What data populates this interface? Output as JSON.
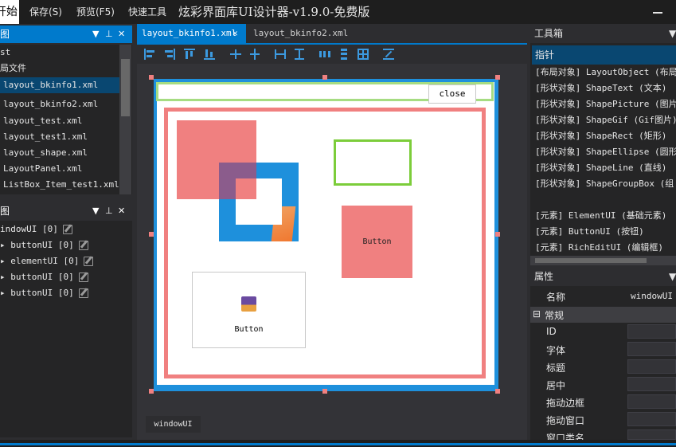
{
  "menubar": {
    "start_label": "开始",
    "save_label": "保存(S)",
    "preview_label": "预览(F5)",
    "quicktools_label": "快速工具",
    "app_title": "炫彩界面库UI设计器-v1.9.0-免费版"
  },
  "project_panel": {
    "title": "图",
    "root_item": "st",
    "folder": "局文件",
    "files": [
      "layout_bkinfo1.xml",
      "layout_bkinfo2.xml",
      "layout_test.xml",
      "layout_test1.xml",
      "layout_shape.xml",
      "LayoutPanel.xml",
      "ListBox_Item_test1.xml"
    ]
  },
  "tree_panel": {
    "title": "图",
    "items": [
      {
        "label": "indowUI [0]",
        "expander": ""
      },
      {
        "label": "buttonUI [0]",
        "expander": "▸"
      },
      {
        "label": "elementUI [0]",
        "expander": "▸"
      },
      {
        "label": "buttonUI [0]",
        "expander": "▸"
      },
      {
        "label": "buttonUI [0]",
        "expander": "▸"
      }
    ]
  },
  "editor": {
    "tabs": [
      {
        "label": "layout_bkinfo1.xml",
        "close": "✕"
      },
      {
        "label": "layout_bkinfo2.xml"
      }
    ],
    "close_button_label": "close",
    "button_label_1": "Button",
    "button_label_2": "Button",
    "window_tag": "windowUI"
  },
  "toolbox": {
    "title": "工具箱",
    "pointer": "指针",
    "items": [
      "[布局对象] LayoutObject (布局",
      "[形状对象] ShapeText (文本)",
      "[形状对象] ShapePicture (图片",
      "[形状对象] ShapeGif (Gif图片)",
      "[形状对象] ShapeRect (矩形)",
      "[形状对象] ShapeEllipse (圆形",
      "[形状对象] ShapeLine (直线)",
      "[形状对象] ShapeGroupBox (组",
      "[元素] ElementUI (基础元素)",
      "[元素] ButtonUI (按钮)",
      "[元素] RichEditUI (编辑框)"
    ]
  },
  "properties": {
    "title": "属性",
    "name_label": "名称",
    "name_value": "windowUI",
    "section": "常规",
    "section_toggle": "⊟",
    "fields": [
      "ID",
      "字体",
      "标题",
      "居中",
      "拖动边框",
      "拖动窗口",
      "窗口类名"
    ]
  },
  "colors": {
    "accent": "#007acc",
    "bg": "#2d2d30",
    "shape_red": "#f08080",
    "shape_green": "#7ccd3a",
    "shape_blue": "#1e90dc"
  }
}
